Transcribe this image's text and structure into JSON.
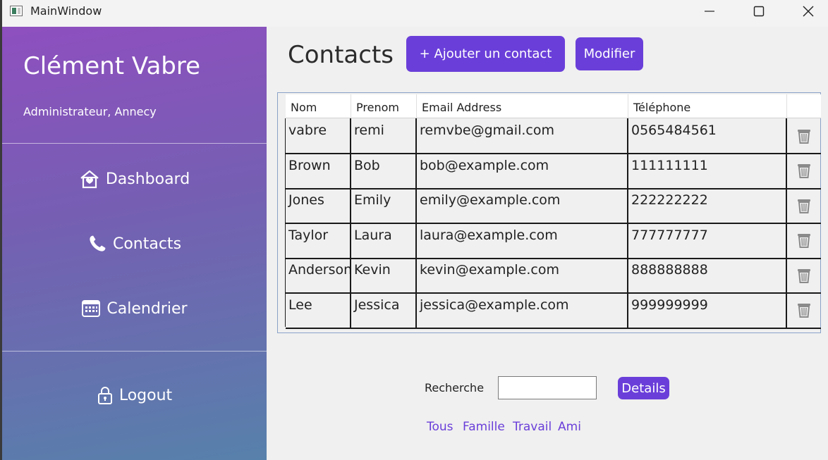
{
  "window": {
    "title": "MainWindow"
  },
  "sidebar": {
    "user_name": "Clément Vabre",
    "user_role": "Administrateur, Annecy",
    "nav": [
      {
        "label": "Dashboard",
        "icon": "house-icon"
      },
      {
        "label": "Contacts",
        "icon": "phone-icon"
      },
      {
        "label": "Calendrier",
        "icon": "calendar-icon"
      }
    ],
    "logout": {
      "label": "Logout",
      "icon": "lock-icon"
    }
  },
  "main": {
    "title": "Contacts",
    "add_button": "+ Ajouter un contact",
    "edit_button": "Modifier"
  },
  "table": {
    "columns": [
      "Nom",
      "Prenom",
      "Email Address",
      "Téléphone"
    ],
    "rows": [
      [
        "vabre",
        "remi",
        "remvbe@gmail.com",
        "0565484561"
      ],
      [
        "Brown",
        "Bob",
        "bob@example.com",
        "111111111"
      ],
      [
        "Jones",
        "Emily",
        "emily@example.com",
        "222222222"
      ],
      [
        "Taylor",
        "Laura",
        "laura@example.com",
        "777777777"
      ],
      [
        "Anderson",
        "Kevin",
        "kevin@example.com",
        "888888888"
      ],
      [
        "Lee",
        "Jessica",
        "jessica@example.com",
        "999999999"
      ]
    ]
  },
  "search": {
    "label": "Recherche",
    "value": "",
    "details_button": "Details"
  },
  "filters": [
    "Tous",
    "Famille",
    "Travail",
    "Ami"
  ],
  "colors": {
    "accent": "#6a3fd9",
    "sidebar_top": "#8e4fbf",
    "sidebar_bottom": "#5781ab"
  }
}
